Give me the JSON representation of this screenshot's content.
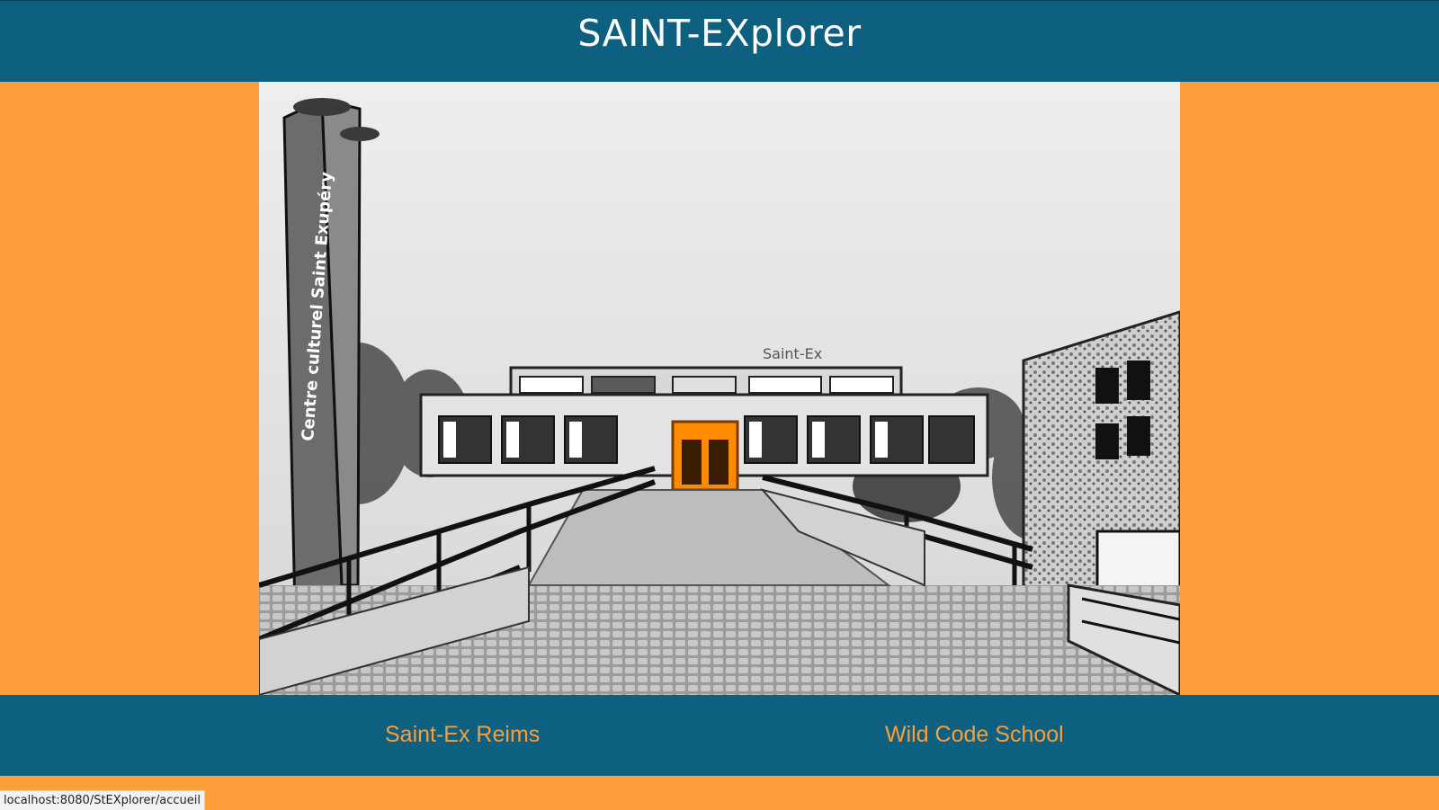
{
  "header": {
    "title": "SAINT-EXplorer"
  },
  "hero": {
    "alt": "Saint-Ex cultural centre building, black and white photo with orange entrance",
    "tower_text": "Centre culturel Saint Exupéry",
    "sign_text": "Saint-Ex"
  },
  "footer": {
    "links": [
      {
        "label": "Saint-Ex Reims"
      },
      {
        "label": "Wild Code School"
      }
    ]
  },
  "status_bar": {
    "url": "localhost:8080/StEXplorer/accueil"
  },
  "colors": {
    "header_bg": "#0d6080",
    "page_bg": "#fd9e3a",
    "accent_orange": "#ff8c00",
    "link_color": "#fd9e3a"
  }
}
